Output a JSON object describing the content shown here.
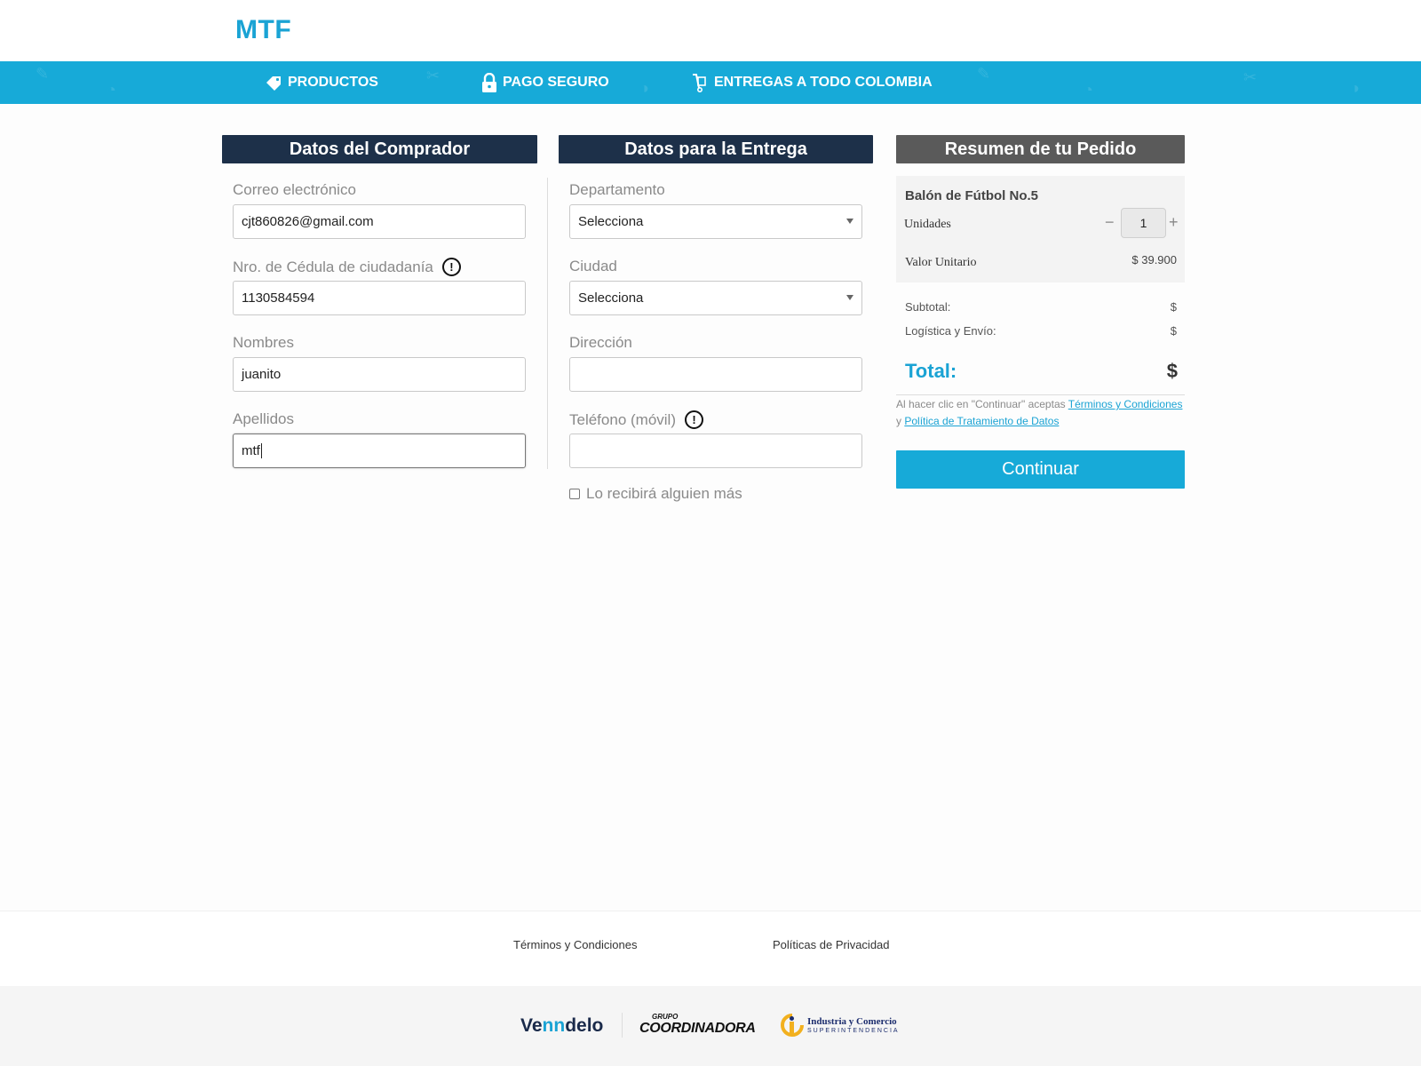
{
  "brand": {
    "name": "MTF"
  },
  "nav": {
    "items": [
      {
        "label": "PRODUCTOS",
        "icon": "tag-icon"
      },
      {
        "label": "PAGO SEGURO",
        "icon": "lock-icon"
      },
      {
        "label": "ENTREGAS A TODO COLOMBIA",
        "icon": "hand-truck-icon"
      }
    ]
  },
  "buyer": {
    "title": "Datos del Comprador",
    "email_label": "Correo electrónico",
    "email_value": "cjt860826@gmail.com",
    "cedula_label": "Nro. de Cédula de ciudadanía",
    "cedula_value": "1130584594",
    "nombres_label": "Nombres",
    "nombres_value": "juanito",
    "apellidos_label": "Apellidos",
    "apellidos_value": "mtf"
  },
  "delivery": {
    "title": "Datos para la Entrega",
    "departamento_label": "Departamento",
    "departamento_value": "Selecciona",
    "ciudad_label": "Ciudad",
    "ciudad_value": "Selecciona",
    "direccion_label": "Dirección",
    "direccion_value": "",
    "telefono_label": "Teléfono (móvil)",
    "telefono_value": "",
    "otro_receptor_label": "Lo recibirá alguien más"
  },
  "summary": {
    "title": "Resumen de tu Pedido",
    "product_name": "Balón de Fútbol No.5",
    "units_label": "Unidades",
    "quantity": "1",
    "minus": "−",
    "plus": "+",
    "unit_value_label": "Valor Unitario",
    "unit_value": "$ 39.900",
    "subtotal_label": "Subtotal:",
    "subtotal_value": "$",
    "shipping_label": "Logística y Envío:",
    "shipping_value": "$",
    "total_label": "Total:",
    "total_value": "$",
    "terms_prefix": "Al hacer clic en \"Continuar\" aceptas ",
    "terms_link": "Términos y Condiciones",
    "terms_middle": " y ",
    "privacy_link": "Política de Tratamiento de Datos",
    "continue_label": "Continuar"
  },
  "footer": {
    "terms_link": "Términos y Condiciones",
    "privacy_link": "Políticas de Privacidad",
    "logos": {
      "vendelo_pre": "Ve",
      "vendelo_mid": "nn",
      "vendelo_post": "delo",
      "coord_small": "GRUPO",
      "coord_name": "COORDINADORA",
      "sic_line1": "Industria y Comercio",
      "sic_line2": "SUPERINTENDENCIA"
    }
  },
  "colors": {
    "brand_blue": "#17aad8",
    "header_dark": "#1d3049",
    "header_gray": "#5a5a5a"
  }
}
